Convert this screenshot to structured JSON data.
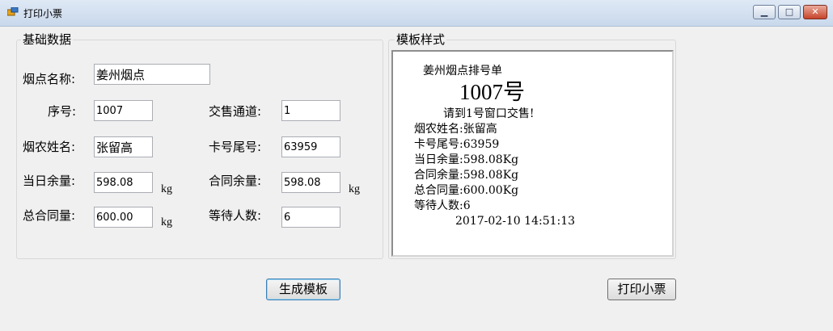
{
  "window": {
    "title": "打印小票",
    "minimize": "▁",
    "maximize": "□",
    "close": "✕",
    "icon": "app-icon"
  },
  "basic": {
    "title": "基础数据",
    "name_label": "烟点名称:",
    "name_value": "姜州烟点",
    "seq_label": "序号:",
    "seq_value": "1007",
    "channel_label": "交售通道:",
    "channel_value": "1",
    "farmer_label": "烟农姓名:",
    "farmer_value": "张留高",
    "card_label": "卡号尾号:",
    "card_value": "63959",
    "today_label": "当日余量:",
    "today_value": "598.08",
    "contract_rem_label": "合同余量:",
    "contract_rem_value": "598.08",
    "total_label": "总合同量:",
    "total_value": "600.00",
    "wait_label": "等待人数:",
    "wait_value": "6",
    "unit": "kg"
  },
  "template": {
    "title": "模板样式",
    "lines": {
      "header": "姜州烟点排号单",
      "number": "1007号",
      "instruction": "请到1号窗口交售!",
      "farmer": "烟农姓名:张留高",
      "card": "卡号尾号:63959",
      "today": "当日余量:598.08Kg",
      "contract_rem": "合同余量:598.08Kg",
      "total": "总合同量:600.00Kg",
      "wait": "等待人数:6",
      "timestamp": "2017-02-10 14:51:13"
    }
  },
  "buttons": {
    "generate": "生成模板",
    "print": "打印小票"
  }
}
